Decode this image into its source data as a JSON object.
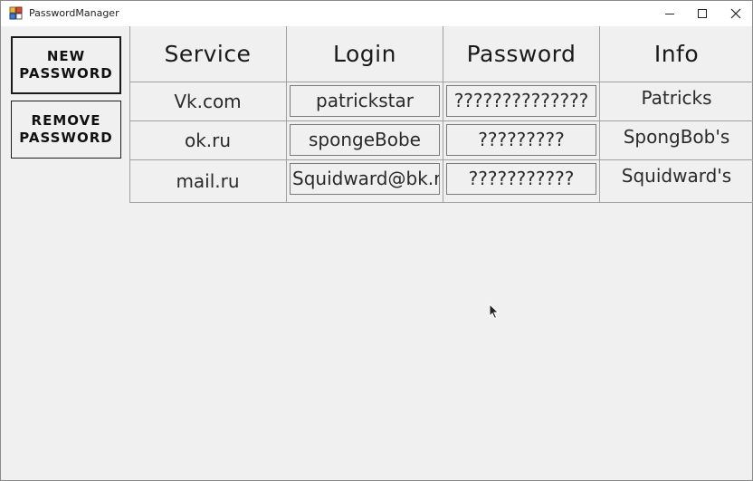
{
  "window": {
    "title": "PasswordManager"
  },
  "sidebar": {
    "new_password": "NEW PASSWORD",
    "remove_password": "REMOVE PASSWORD"
  },
  "table": {
    "headers": [
      "Service",
      "Login",
      "Password",
      "Info"
    ],
    "rows": [
      {
        "service": "Vk.com",
        "login": "patrickstar",
        "password": "??????????????",
        "info": "Patricks"
      },
      {
        "service": "ok.ru",
        "login": "spongeBobe",
        "password": "?????????",
        "info": "SpongBob's"
      },
      {
        "service": "mail.ru",
        "login": "Squidward@bk.ru",
        "password": "???????????",
        "info": "Squidward's"
      }
    ]
  }
}
